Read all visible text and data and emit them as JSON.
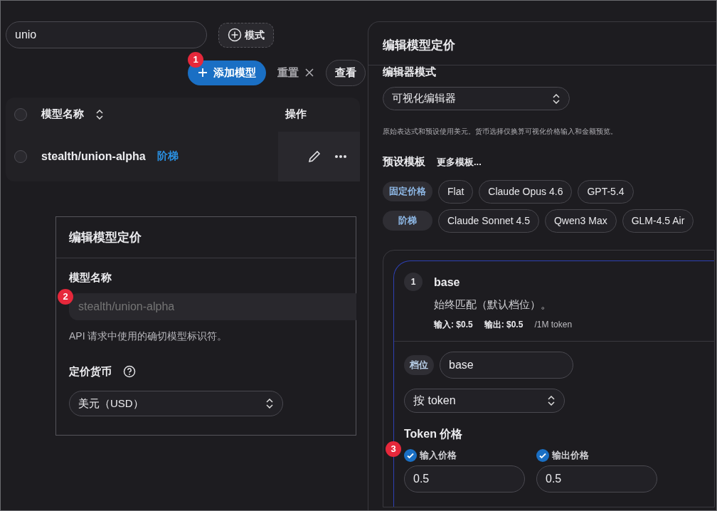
{
  "search": {
    "value": "unio"
  },
  "mode_button": {
    "label": "模式"
  },
  "toolbar": {
    "add_button": {
      "label": "添加模型",
      "annotation": "1"
    },
    "reset": {
      "label": "重置"
    },
    "view_button": {
      "label": "查看"
    }
  },
  "table": {
    "all_selected": false,
    "columns": [
      {
        "label": "模型名称",
        "sortable": true
      },
      {
        "label": "操作",
        "sortable": false
      }
    ],
    "rows": [
      {
        "selected": false,
        "name": "stealth/union-alpha",
        "tag": "阶梯"
      }
    ]
  },
  "dialog": {
    "title": "编辑模型定价",
    "name_label": "模型名称",
    "name_placeholder": "stealth/union-alpha",
    "annotation": "2",
    "help": "API 请求中使用的确切模型标识符。",
    "currency_label": "定价货币",
    "currency_value": "美元（USD）"
  },
  "editor": {
    "title": "编辑模型定价",
    "mode_label": "编辑器模式",
    "mode_value": "可视化编辑器",
    "note": "原始表达式和预设使用美元。货币选择仅换算可视化价格输入和金额预览。",
    "presets_label": "预设模板",
    "more_link": "更多模板...",
    "preset_groups": [
      {
        "label": "固定价格",
        "items": [
          "Flat",
          "Claude Opus 4.6",
          "GPT-5.4"
        ]
      },
      {
        "label": "阶梯",
        "items": [
          "Claude Sonnet 4.5",
          "Qwen3 Max",
          "GLM-4.5 Air"
        ]
      }
    ],
    "tier": {
      "index": "1",
      "name": "base",
      "description": "始终匹配（默认档位）。",
      "input_summary": "输入: $0.5",
      "output_summary": "输出: $0.5",
      "unit": "/1M token",
      "tier_label": "档位",
      "tier_value": "base",
      "billing_value": "按 token",
      "price_title": "Token 价格",
      "annotation": "3",
      "prices": [
        {
          "label": "输入价格",
          "checked": true,
          "value": "0.5"
        },
        {
          "label": "输出价格",
          "checked": true,
          "value": "0.5"
        }
      ]
    }
  }
}
